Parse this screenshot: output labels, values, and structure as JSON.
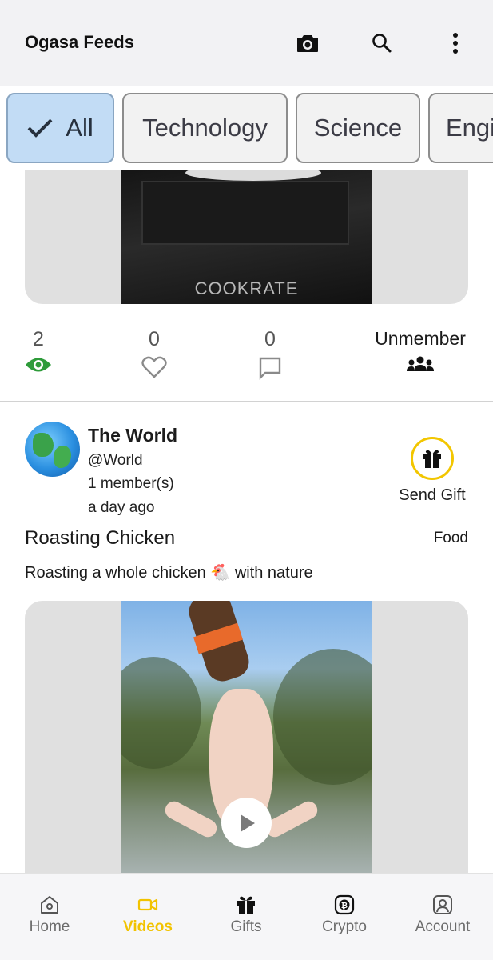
{
  "appbar": {
    "title": "Ogasa Feeds",
    "icons": [
      "camera-icon",
      "search-icon",
      "more-vert-icon"
    ]
  },
  "filters": {
    "items": [
      "All",
      "Technology",
      "Science",
      "Engi"
    ],
    "selected": "All"
  },
  "post1": {
    "brand_watermark": "COOKRATE",
    "stats": {
      "views": "2",
      "likes": "0",
      "comments": "0",
      "member_label": "Unmember"
    }
  },
  "post2": {
    "author": {
      "name": "The World",
      "handle": "@World",
      "members": "1 member(s)",
      "time": "a day ago"
    },
    "gift_label": "Send Gift",
    "title": "Roasting Chicken",
    "category": "Food",
    "description": "Roasting a whole chicken 🐔 with nature"
  },
  "nav": {
    "items": [
      {
        "label": "Home",
        "icon": "home-icon"
      },
      {
        "label": "Videos",
        "icon": "video-icon"
      },
      {
        "label": "Gifts",
        "icon": "gift-icon"
      },
      {
        "label": "Crypto",
        "icon": "bitcoin-icon"
      },
      {
        "label": "Account",
        "icon": "account-icon"
      }
    ],
    "active": "Videos"
  },
  "colors": {
    "accent": "#f2c300",
    "views_icon": "#2e9b3a",
    "chip_selected": "#c2dcf5"
  }
}
